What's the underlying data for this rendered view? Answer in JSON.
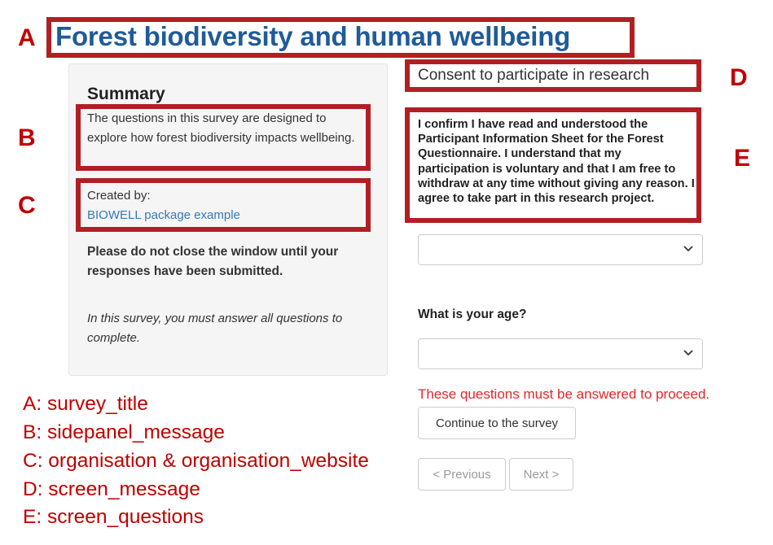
{
  "survey": {
    "title": "Forest biodiversity and human wellbeing"
  },
  "sidebar": {
    "heading": "Summary",
    "message": "The questions in this survey are designed to explore how forest biodiversity impacts wellbeing.",
    "created_by_label": "Created by:",
    "organisation_link": "BIOWELL package example",
    "close_warning": "Please do not close the window until your responses have been submitted.",
    "answer_all_note": "In this survey, you must answer all questions to complete."
  },
  "main": {
    "screen_message": "Consent to participate in research",
    "consent_text": "I confirm I have read and understood the Participant Information Sheet for the Forest Questionnaire. I understand that my participation is voluntary and that I am free to withdraw at any time without giving any reason. I agree to take part in this research project.",
    "consent_select_value": "",
    "age_label": "What is your age?",
    "age_select_value": "",
    "error_message": "These questions must be answered to proceed.",
    "continue_label": "Continue to the survey",
    "previous_label": "< Previous",
    "next_label": "Next >"
  },
  "annotation": {
    "markers": [
      "A",
      "B",
      "C",
      "D",
      "E"
    ],
    "legend": [
      "A: survey_title",
      "B: sidepanel_message",
      "C: organisation & organisation_website",
      "D: screen_message",
      "E: screen_questions"
    ],
    "color": "#c00000"
  }
}
